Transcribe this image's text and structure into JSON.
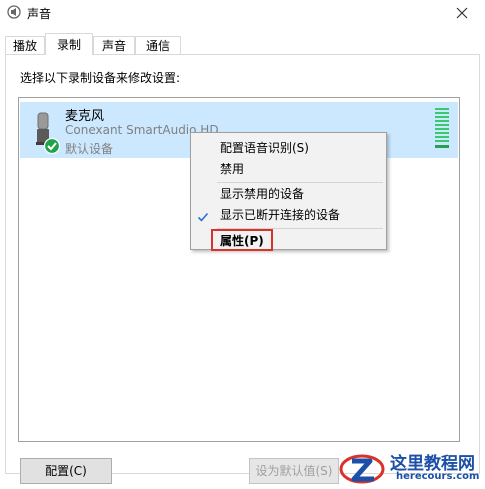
{
  "window": {
    "title": "声音"
  },
  "tabs": [
    {
      "label": "播放",
      "selected": false
    },
    {
      "label": "录制",
      "selected": true
    },
    {
      "label": "声音",
      "selected": false
    },
    {
      "label": "通信",
      "selected": false
    }
  ],
  "instruction": "选择以下录制设备来修改设置:",
  "device": {
    "name": "麦克风",
    "description": "Conexant SmartAudio HD",
    "status": "默认设备",
    "icon": "microphone-icon",
    "status_icon": "default-check-icon"
  },
  "context_menu": {
    "items": [
      {
        "label": "配置语音识别(S)",
        "checked": false
      },
      {
        "label": "禁用",
        "checked": false
      },
      {
        "label": "显示禁用的设备",
        "checked": false
      },
      {
        "label": "显示已断开连接的设备",
        "checked": true
      },
      {
        "label": "属性(P)",
        "checked": false,
        "highlighted": true
      }
    ]
  },
  "buttons": {
    "configure": "配置(C)",
    "set_default": "设为默认值(S)"
  },
  "watermark": {
    "title": "这里教程网",
    "url": "herecours.com"
  },
  "colors": {
    "selection": "#cce8ff",
    "level_meter": "#39c86e",
    "highlight_border": "#d9322b",
    "watermark": "#1b4fa8"
  }
}
